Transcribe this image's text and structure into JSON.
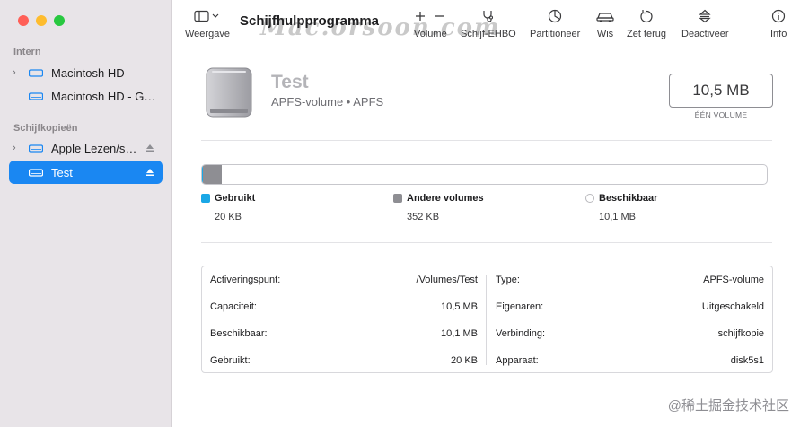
{
  "window": {
    "title": "Schijfhulpprogramma"
  },
  "sidebar": {
    "sections": [
      {
        "label": "Intern"
      },
      {
        "label": "Schijfkopieën"
      }
    ],
    "items": [
      {
        "label": "Macintosh HD",
        "has_chevron": true
      },
      {
        "label": "Macintosh HD - G…",
        "has_chevron": false
      },
      {
        "label": "Apple Lezen/s…",
        "has_chevron": true,
        "has_eject": true
      },
      {
        "label": "Test",
        "has_chevron": false,
        "has_eject": true,
        "selected": true
      }
    ]
  },
  "toolbar": {
    "view_label": "Weergave",
    "volume_label": "Volume",
    "firstaid_label": "Schijf-EHBO",
    "partition_label": "Partitioneer",
    "erase_label": "Wis",
    "restore_label": "Zet terug",
    "unmount_label": "Deactiveer",
    "info_label": "Info"
  },
  "volume": {
    "name": "Test",
    "subtitle": "APFS-volume • APFS",
    "size": "10,5 MB",
    "size_caption": "ÉÉN VOLUME"
  },
  "usage": {
    "used_fraction": 0.002,
    "other_fraction": 0.033,
    "legend": [
      {
        "name": "Gebruikt",
        "value": "20 KB",
        "color": "#1aa7e6"
      },
      {
        "name": "Andere volumes",
        "value": "352 KB",
        "color": "#8e8e93"
      },
      {
        "name": "Beschikbaar",
        "value": "10,1 MB",
        "color": "#ffffff"
      }
    ]
  },
  "info": {
    "left": [
      {
        "key": "Activeringspunt:",
        "value": "/Volumes/Test"
      },
      {
        "key": "Capaciteit:",
        "value": "10,5 MB"
      },
      {
        "key": "Beschikbaar:",
        "value": "10,1 MB"
      },
      {
        "key": "Gebruikt:",
        "value": "20 KB"
      }
    ],
    "right": [
      {
        "key": "Type:",
        "value": "APFS-volume"
      },
      {
        "key": "Eigenaren:",
        "value": "Uitgeschakeld"
      },
      {
        "key": "Verbinding:",
        "value": "schijfkopie"
      },
      {
        "key": "Apparaat:",
        "value": "disk5s1"
      }
    ]
  },
  "watermarks": {
    "top": "Mac.orsoon.com",
    "bottom": "@稀土掘金技术社区"
  },
  "colors": {
    "accent": "#1a87f2",
    "used": "#1aa7e6",
    "other": "#8e8e93"
  }
}
